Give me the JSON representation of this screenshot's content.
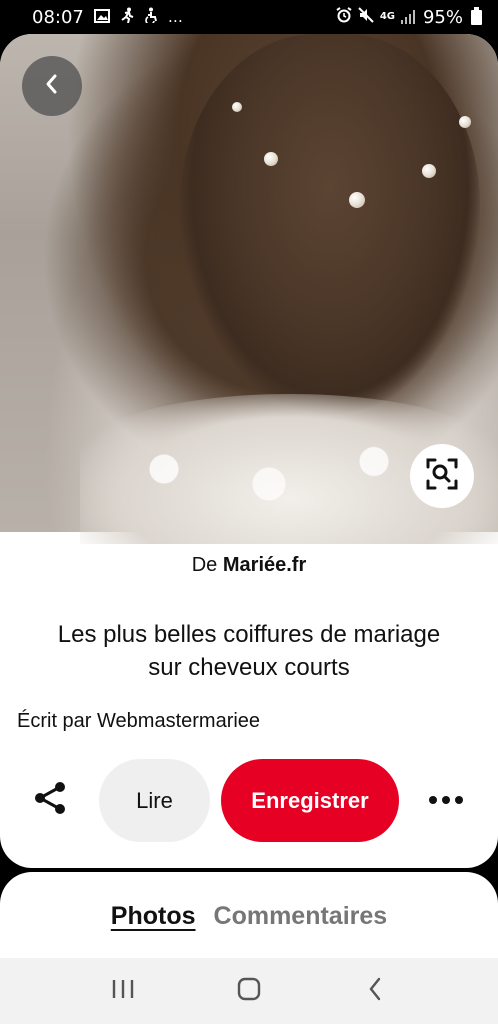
{
  "status_bar": {
    "time": "08:07",
    "network": "4G",
    "battery": "95%",
    "more": "…"
  },
  "pin": {
    "source_prefix": "De",
    "source_name": "Mariée.fr",
    "title": "Les plus belles coiffures de mariage sur cheveux courts",
    "author": "Écrit par Webmastermariee"
  },
  "actions": {
    "read_label": "Lire",
    "save_label": "Enregistrer"
  },
  "tabs": [
    {
      "label": "Photos",
      "active": true
    },
    {
      "label": "Commentaires",
      "active": false
    }
  ],
  "colors": {
    "accent": "#e60023",
    "secondary_button": "#efefef",
    "inactive_tab": "#767676"
  }
}
